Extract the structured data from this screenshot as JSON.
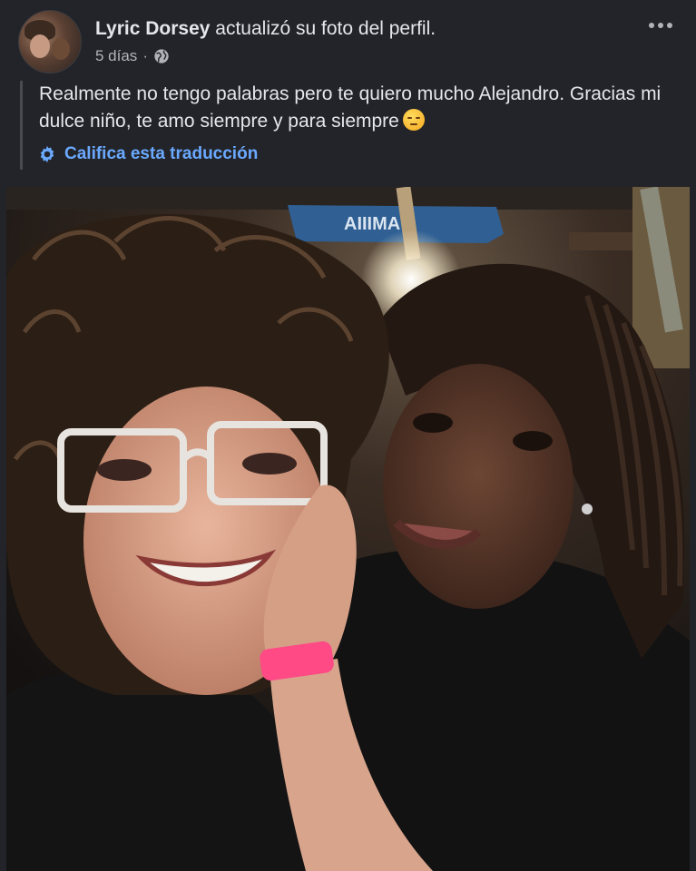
{
  "post": {
    "author": "Lyric Dorsey",
    "action": "actualizó su foto del perfil.",
    "time": "5 días",
    "separator": "·",
    "privacy_icon": "globe-icon",
    "more_icon": "ellipsis-icon",
    "caption": "Realmente no tengo palabras pero te quiero mucho Alejandro. Gracias mi dulce niño, te amo siempre y para siempre",
    "caption_emoji": "pensive-face-emoji",
    "translate_label": "Califica esta traducción",
    "translate_icon": "gear-icon",
    "photo_sign_text": "AIIIMA"
  },
  "colors": {
    "background": "#232429",
    "text": "#e4e6eb",
    "secondary_text": "#b0b3b8",
    "link": "#6aa9ff"
  }
}
